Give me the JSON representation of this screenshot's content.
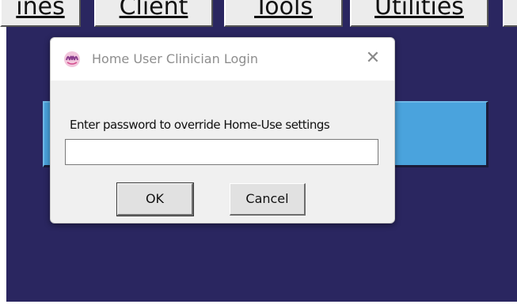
{
  "menubar": {
    "tabs": [
      {
        "label": "ines"
      },
      {
        "label": "Client"
      },
      {
        "label": "Tools"
      },
      {
        "label": "Utilities"
      }
    ]
  },
  "dialog": {
    "title": "Home User Clinician Login",
    "close_symbol": "✕",
    "prompt": "Enter password to override Home-Use settings",
    "password_value": "",
    "ok_label": "OK",
    "cancel_label": "Cancel"
  },
  "colors": {
    "app_background": "#2a2660",
    "blue_bar": "#4aa3dd",
    "dialog_background": "#f0f0f0"
  }
}
